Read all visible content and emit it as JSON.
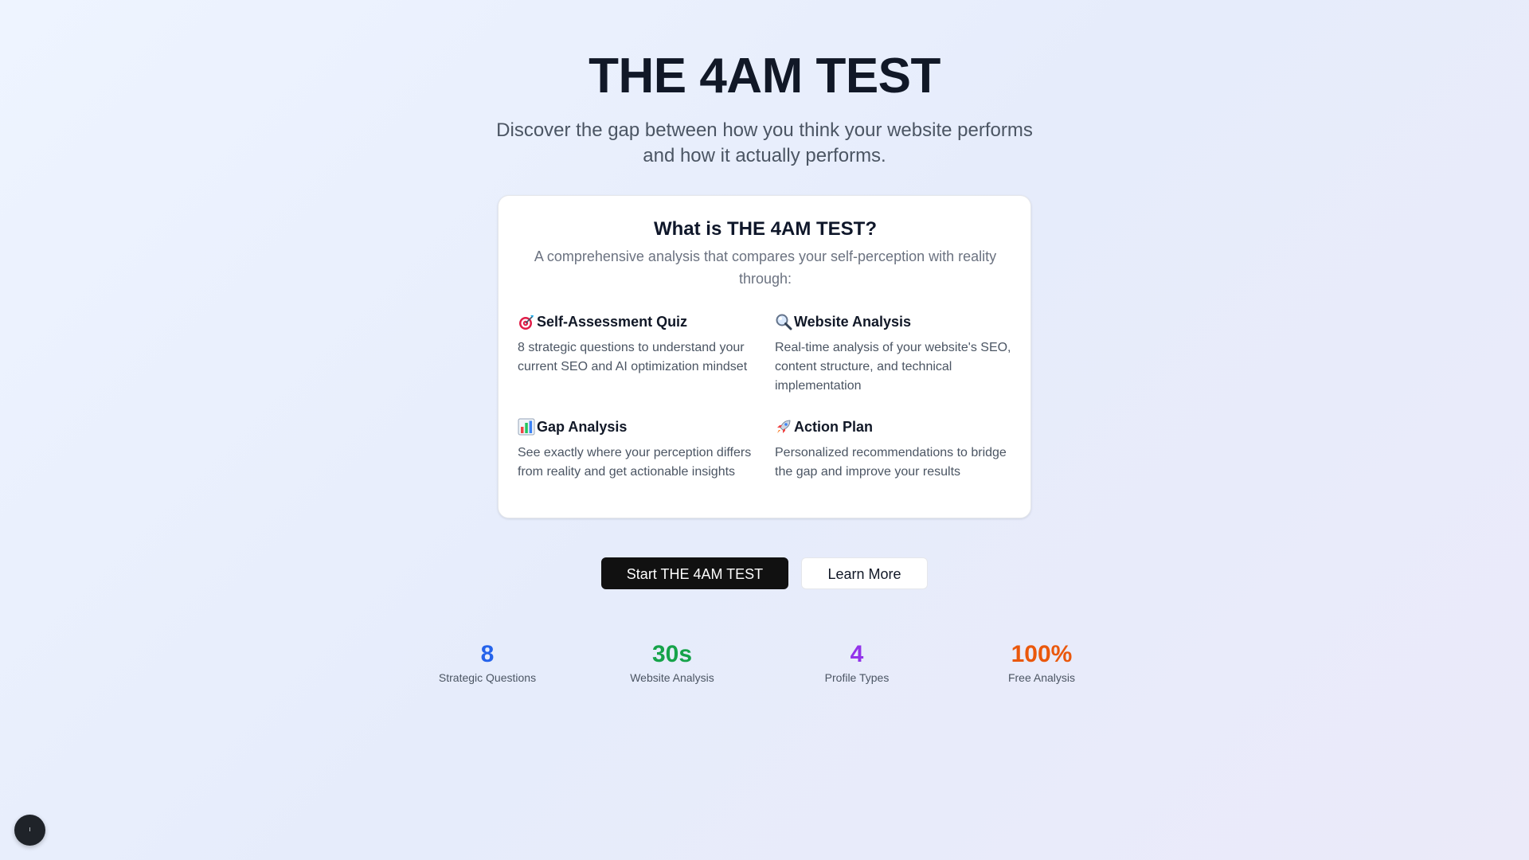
{
  "hero": {
    "title": "THE 4AM TEST",
    "subtitle": "Discover the gap between how you think your website performs and how it actually performs."
  },
  "card": {
    "title": "What is THE 4AM TEST?",
    "description": "A comprehensive analysis that compares your self-perception with reality through:",
    "features": [
      {
        "icon": "target-icon",
        "title": "Self-Assessment Quiz",
        "text": "8 strategic questions to understand your current SEO and AI optimization mindset"
      },
      {
        "icon": "magnifier-icon",
        "title": "Website Analysis",
        "text": "Real-time analysis of your website's SEO, content structure, and technical implementation"
      },
      {
        "icon": "bar-chart-icon",
        "title": "Gap Analysis",
        "text": "See exactly where your perception differs from reality and get actionable insights"
      },
      {
        "icon": "rocket-icon",
        "title": "Action Plan",
        "text": "Personalized recommendations to bridge the gap and improve your results"
      }
    ]
  },
  "actions": {
    "primary_label": "Start THE 4AM TEST",
    "secondary_label": "Learn More"
  },
  "stats": [
    {
      "value": "8",
      "label": "Strategic Questions",
      "color": "#2563eb"
    },
    {
      "value": "30s",
      "label": "Website Analysis",
      "color": "#16a34a"
    },
    {
      "value": "4",
      "label": "Profile Types",
      "color": "#9333ea"
    },
    {
      "value": "100%",
      "label": "Free Analysis",
      "color": "#ea580c"
    }
  ],
  "fab": {
    "glyph": "ı",
    "icon": "info-icon"
  }
}
